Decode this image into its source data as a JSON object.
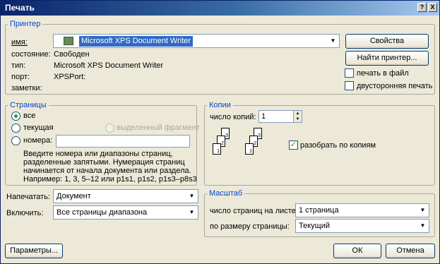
{
  "window": {
    "title": "Печать",
    "help_glyph": "?",
    "close_glyph": "X"
  },
  "printer": {
    "group_label": "Принтер",
    "name_label": "имя:",
    "name_value": "Microsoft XPS Document Writer",
    "status_label": "состояние:",
    "status_value": "Свободен",
    "type_label": "тип:",
    "type_value": "Microsoft XPS Document Writer",
    "port_label": "порт:",
    "port_value": "XPSPort:",
    "notes_label": "заметки:",
    "properties_button": "Свойства",
    "find_button": "Найти принтер...",
    "print_to_file": "печать в файл",
    "duplex": "двусторонняя печать"
  },
  "pages": {
    "group_label": "Страницы",
    "all": "все",
    "current": "текущая",
    "selection": "выделенный фрагмент",
    "numbers": "номера:",
    "numbers_value": "",
    "help_line1": "Введите номера или диапазоны страниц,",
    "help_line2": "разделенные запятыми. Нумерация страниц",
    "help_line3": "начинается от начала документа или раздела.",
    "help_line4": "Например: 1, 3, 5–12 или p1s1, p1s2, p1s3–p8s3"
  },
  "copies": {
    "group_label": "Копии",
    "count_label": "число копий:",
    "count_value": "1",
    "collate": "разобрать по копиям",
    "collate_checked": true,
    "page_numbers": [
      "1",
      "2",
      "3"
    ]
  },
  "print_what": {
    "label": "Напечатать:",
    "value": "Документ"
  },
  "include": {
    "label": "Включить:",
    "value": "Все страницы диапазона"
  },
  "zoom": {
    "group_label": "Масштаб",
    "pages_per_sheet_label": "число страниц на листе:",
    "pages_per_sheet_value": "1 страница",
    "scale_label": "по размеру страницы:",
    "scale_value": "Текущий"
  },
  "footer": {
    "options_button": "Параметры...",
    "ok_button": "ОК",
    "cancel_button": "Отмена"
  }
}
